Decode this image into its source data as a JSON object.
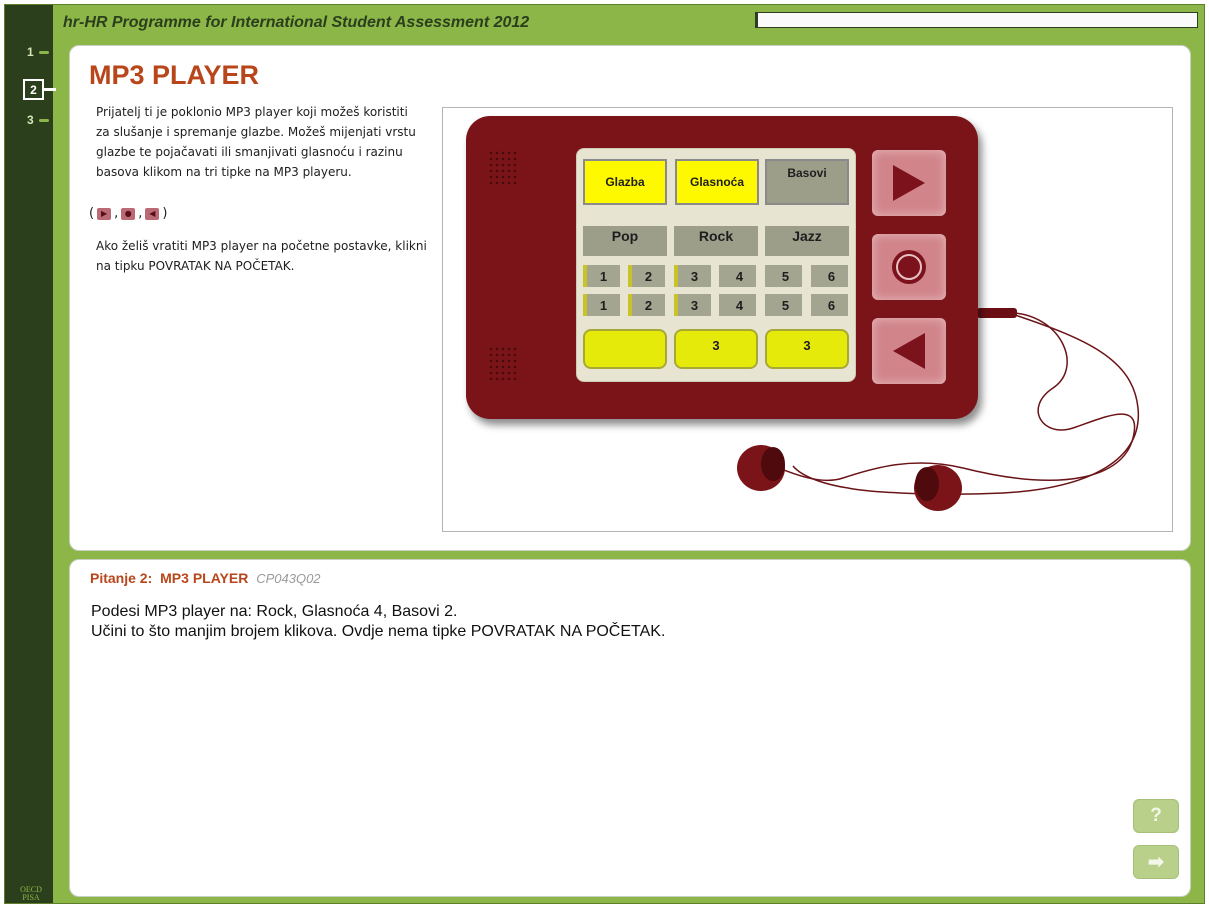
{
  "app": {
    "title": "hr-HR Programme for International Student Assessment 2012",
    "progress_fraction": 0.0
  },
  "nav": {
    "items": [
      {
        "label": "1"
      },
      {
        "label": "2"
      },
      {
        "label": "3"
      }
    ],
    "current_index": 1,
    "logo_text": "OECD PISA"
  },
  "stimulus": {
    "title": "MP3 PLAYER",
    "intro": "Prijatelj ti je poklonio MP3 player koji možeš koristiti za slušanje i spremanje glazbe. Možeš mijenjati vrstu glazbe te pojačavati ili smanjivati glasnoću i razinu basova klikom na tri tipke na MP3 playeru.",
    "icon_open": "(",
    "icon_sep": ",",
    "icon_close": ")",
    "icon_glyphs": [
      "▶",
      "●",
      "◀"
    ],
    "reset_text": "Ako želiš vratiti MP3 player na početne postavke, klikni na tipku POVRATAK NA POČETAK."
  },
  "player": {
    "categories": [
      {
        "label": "Glazba",
        "state": "on"
      },
      {
        "label": "Glasnoća",
        "state": "on"
      },
      {
        "label": "Basovi",
        "state": "off"
      }
    ],
    "types": [
      "Pop",
      "Rock",
      "Jazz"
    ],
    "scale_rows": [
      [
        "1",
        "2",
        "3",
        "4",
        "5",
        "6"
      ],
      [
        "1",
        "2",
        "3",
        "4",
        "5",
        "6"
      ]
    ],
    "values": [
      "",
      "3",
      "3"
    ],
    "controls": [
      {
        "name": "forward-button",
        "icon": "triangle-right-icon"
      },
      {
        "name": "select-button",
        "icon": "circle-icon"
      },
      {
        "name": "back-button",
        "icon": "triangle-left-icon"
      }
    ],
    "colors": {
      "body": "#7a1418",
      "active": "#fff900",
      "value": "#e6ea0a",
      "button": "#d1858b"
    }
  },
  "question": {
    "label": "Pitanje 2:",
    "unit": "MP3 PLAYER",
    "code": "CP043Q02",
    "line1": "Podesi MP3 player na: Rock, Glasnoća 4, Basovi 2.",
    "line2": "Učini to što manjim brojem klikova. Ovdje nema tipke POVRATAK NA POČETAK."
  },
  "side_buttons": {
    "help": "?",
    "next": "➡"
  }
}
